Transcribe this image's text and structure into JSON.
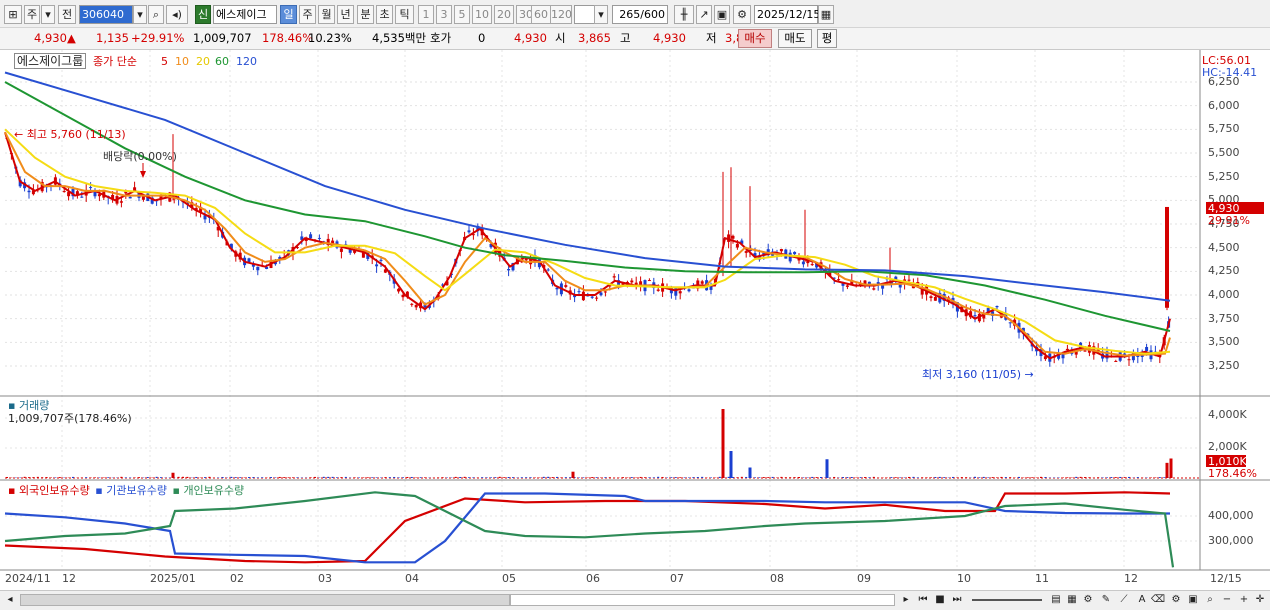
{
  "toolbar": {
    "period_label": "주",
    "prev_label": "전",
    "stock_code": "306040",
    "sin_label": "신",
    "stock_name": "에스제이그",
    "periods": [
      "일",
      "주",
      "월",
      "년",
      "분",
      "초",
      "틱"
    ],
    "intervals": [
      "1",
      "3",
      "5",
      "10",
      "20",
      "30",
      "60",
      "120"
    ],
    "count": "265",
    "count_max": "/600",
    "date": "2025/12/15"
  },
  "quote": {
    "price": "4,930",
    "arrow": "▲",
    "change": "1,135",
    "change_pct": "+29.91%",
    "volume": "1,009,707",
    "vol_ratio": "178.46%",
    "turnover": "10.23%",
    "amount": "4,535백만",
    "hoga_label": "호가",
    "hoga_value": "0",
    "hoga_price": "4,930",
    "open_label": "시",
    "open": "3,865",
    "high_label": "고",
    "high": "4,930",
    "low_label": "저",
    "low": "3,840",
    "buy_label": "매수",
    "sell_label": "매도",
    "eval_label": "평"
  },
  "price_panel": {
    "title": "에스제이그룹",
    "ma_title": "종가 단순",
    "ma_periods": [
      "5",
      "10",
      "20",
      "60",
      "120"
    ],
    "lc": "LC:56.01",
    "hc": "HC:-14.41",
    "last_price": "4,930",
    "last_pct": "29.91%",
    "high_marker": "최고 5,760 (11/13)",
    "low_marker": "최저 3,160 (11/05)",
    "dividend_marker": "배당락(0.00%)",
    "y_ticks": [
      "6,250",
      "6,000",
      "5,750",
      "5,500",
      "5,250",
      "5,000",
      "4,750",
      "4,500",
      "4,250",
      "4,000",
      "3,750",
      "3,500",
      "3,250"
    ]
  },
  "volume_panel": {
    "title": "거래량",
    "value": "1,009,707주(178.46%)",
    "y_ticks": [
      "4,000K",
      "2,000K"
    ],
    "last_value": "1,010K",
    "last_pct": "178.46%"
  },
  "holding_panel": {
    "legend": [
      "외국인보유수량",
      "기관보유수량",
      "개인보유수량"
    ],
    "y_ticks": [
      "400,000",
      "300,000"
    ]
  },
  "x_axis": [
    "2024/11",
    "12",
    "2025/01",
    "02",
    "03",
    "04",
    "05",
    "06",
    "07",
    "08",
    "09",
    "10",
    "11",
    "12",
    "12/15"
  ],
  "colors": {
    "ma5": "#d40000",
    "ma10": "#f08c1a",
    "ma20": "#f5dc14",
    "ma60": "#1e9632",
    "ma120": "#2850d2",
    "foreign": "#d40000",
    "institution": "#2850d2",
    "individual": "#2e8b57"
  },
  "chart_data": {
    "type": "candlestick",
    "title": "에스제이그룹",
    "x_range": [
      "2024/11",
      "2025/12/15"
    ],
    "price_ylim": [
      3160,
      6300
    ],
    "price_series": [
      {
        "name": "종가 단순 5",
        "color": "#d40000",
        "points": [
          [
            0,
            5720
          ],
          [
            15,
            5200
          ],
          [
            30,
            5100
          ],
          [
            50,
            5200
          ],
          [
            70,
            5050
          ],
          [
            90,
            5100
          ],
          [
            110,
            5000
          ],
          [
            130,
            5100
          ],
          [
            150,
            5000
          ],
          [
            170,
            5050
          ],
          [
            190,
            4900
          ],
          [
            210,
            4800
          ],
          [
            225,
            4500
          ],
          [
            240,
            4350
          ],
          [
            260,
            4300
          ],
          [
            280,
            4400
          ],
          [
            300,
            4600
          ],
          [
            320,
            4550
          ],
          [
            340,
            4500
          ],
          [
            360,
            4450
          ],
          [
            380,
            4300
          ],
          [
            400,
            4000
          ],
          [
            420,
            3850
          ],
          [
            430,
            3950
          ],
          [
            445,
            4200
          ],
          [
            460,
            4600
          ],
          [
            475,
            4700
          ],
          [
            490,
            4500
          ],
          [
            505,
            4300
          ],
          [
            520,
            4400
          ],
          [
            535,
            4350
          ],
          [
            550,
            4100
          ],
          [
            570,
            4000
          ],
          [
            590,
            4000
          ],
          [
            610,
            4150
          ],
          [
            630,
            4100
          ],
          [
            650,
            4100
          ],
          [
            670,
            4050
          ],
          [
            690,
            4100
          ],
          [
            710,
            4100
          ],
          [
            720,
            4600
          ],
          [
            735,
            4550
          ],
          [
            750,
            4400
          ],
          [
            770,
            4450
          ],
          [
            790,
            4400
          ],
          [
            810,
            4350
          ],
          [
            830,
            4150
          ],
          [
            850,
            4100
          ],
          [
            870,
            4100
          ],
          [
            890,
            4150
          ],
          [
            910,
            4100
          ],
          [
            930,
            4000
          ],
          [
            950,
            3900
          ],
          [
            970,
            3750
          ],
          [
            990,
            3850
          ],
          [
            1010,
            3700
          ],
          [
            1030,
            3450
          ],
          [
            1045,
            3330
          ],
          [
            1060,
            3400
          ],
          [
            1080,
            3450
          ],
          [
            1100,
            3350
          ],
          [
            1120,
            3350
          ],
          [
            1140,
            3400
          ],
          [
            1155,
            3350
          ],
          [
            1165,
            3750
          ]
        ]
      },
      {
        "name": "종가 단순 10",
        "color": "#f08c1a",
        "points": [
          [
            0,
            5720
          ],
          [
            20,
            5300
          ],
          [
            40,
            5150
          ],
          [
            60,
            5150
          ],
          [
            80,
            5100
          ],
          [
            100,
            5100
          ],
          [
            120,
            5050
          ],
          [
            140,
            5050
          ],
          [
            160,
            5050
          ],
          [
            180,
            5000
          ],
          [
            200,
            4900
          ],
          [
            220,
            4700
          ],
          [
            240,
            4450
          ],
          [
            260,
            4350
          ],
          [
            280,
            4380
          ],
          [
            300,
            4500
          ],
          [
            320,
            4550
          ],
          [
            340,
            4520
          ],
          [
            360,
            4470
          ],
          [
            380,
            4380
          ],
          [
            400,
            4150
          ],
          [
            420,
            3900
          ],
          [
            440,
            4000
          ],
          [
            460,
            4350
          ],
          [
            480,
            4600
          ],
          [
            500,
            4450
          ],
          [
            520,
            4350
          ],
          [
            540,
            4350
          ],
          [
            560,
            4150
          ],
          [
            580,
            4050
          ],
          [
            600,
            4050
          ],
          [
            620,
            4100
          ],
          [
            640,
            4100
          ],
          [
            660,
            4080
          ],
          [
            680,
            4080
          ],
          [
            700,
            4090
          ],
          [
            720,
            4300
          ],
          [
            740,
            4500
          ],
          [
            760,
            4450
          ],
          [
            780,
            4420
          ],
          [
            800,
            4400
          ],
          [
            820,
            4300
          ],
          [
            840,
            4170
          ],
          [
            860,
            4110
          ],
          [
            880,
            4110
          ],
          [
            900,
            4120
          ],
          [
            920,
            4070
          ],
          [
            940,
            3980
          ],
          [
            960,
            3870
          ],
          [
            980,
            3800
          ],
          [
            1000,
            3780
          ],
          [
            1020,
            3600
          ],
          [
            1040,
            3400
          ],
          [
            1060,
            3380
          ],
          [
            1080,
            3430
          ],
          [
            1100,
            3390
          ],
          [
            1120,
            3360
          ],
          [
            1140,
            3370
          ],
          [
            1160,
            3380
          ],
          [
            1165,
            3550
          ]
        ]
      },
      {
        "name": "종가 단순 20",
        "color": "#f5dc14",
        "points": [
          [
            0,
            5750
          ],
          [
            30,
            5450
          ],
          [
            60,
            5250
          ],
          [
            90,
            5150
          ],
          [
            120,
            5100
          ],
          [
            150,
            5080
          ],
          [
            180,
            5050
          ],
          [
            210,
            4920
          ],
          [
            240,
            4650
          ],
          [
            270,
            4450
          ],
          [
            300,
            4450
          ],
          [
            330,
            4520
          ],
          [
            360,
            4520
          ],
          [
            390,
            4440
          ],
          [
            420,
            4200
          ],
          [
            440,
            4050
          ],
          [
            460,
            4220
          ],
          [
            490,
            4480
          ],
          [
            520,
            4450
          ],
          [
            550,
            4330
          ],
          [
            580,
            4180
          ],
          [
            610,
            4100
          ],
          [
            640,
            4090
          ],
          [
            670,
            4080
          ],
          [
            700,
            4080
          ],
          [
            720,
            4160
          ],
          [
            750,
            4380
          ],
          [
            780,
            4420
          ],
          [
            810,
            4400
          ],
          [
            840,
            4320
          ],
          [
            870,
            4200
          ],
          [
            900,
            4140
          ],
          [
            930,
            4080
          ],
          [
            960,
            3960
          ],
          [
            990,
            3850
          ],
          [
            1020,
            3720
          ],
          [
            1050,
            3520
          ],
          [
            1080,
            3450
          ],
          [
            1110,
            3410
          ],
          [
            1140,
            3380
          ],
          [
            1165,
            3400
          ]
        ]
      },
      {
        "name": "종가 단순 60",
        "color": "#1e9632",
        "points": [
          [
            0,
            6250
          ],
          [
            60,
            5900
          ],
          [
            120,
            5550
          ],
          [
            180,
            5250
          ],
          [
            240,
            5000
          ],
          [
            300,
            4850
          ],
          [
            360,
            4780
          ],
          [
            420,
            4620
          ],
          [
            460,
            4500
          ],
          [
            500,
            4420
          ],
          [
            560,
            4360
          ],
          [
            620,
            4290
          ],
          [
            680,
            4250
          ],
          [
            740,
            4240
          ],
          [
            800,
            4240
          ],
          [
            860,
            4250
          ],
          [
            920,
            4210
          ],
          [
            980,
            4100
          ],
          [
            1040,
            3950
          ],
          [
            1100,
            3780
          ],
          [
            1165,
            3620
          ]
        ]
      },
      {
        "name": "종가 단순 120",
        "color": "#2850d2",
        "points": [
          [
            0,
            6350
          ],
          [
            80,
            6100
          ],
          [
            160,
            5850
          ],
          [
            240,
            5500
          ],
          [
            320,
            5150
          ],
          [
            400,
            4900
          ],
          [
            480,
            4700
          ],
          [
            560,
            4530
          ],
          [
            640,
            4390
          ],
          [
            720,
            4300
          ],
          [
            800,
            4270
          ],
          [
            880,
            4260
          ],
          [
            960,
            4200
          ],
          [
            1040,
            4100
          ],
          [
            1100,
            4030
          ],
          [
            1165,
            3940
          ]
        ]
      }
    ],
    "holding_series": [
      {
        "name": "외국인보유수량",
        "color": "#d40000",
        "points": [
          [
            0,
            282
          ],
          [
            80,
            268
          ],
          [
            160,
            238
          ],
          [
            240,
            220
          ],
          [
            300,
            215
          ],
          [
            360,
            220
          ],
          [
            375,
            280
          ],
          [
            400,
            380
          ],
          [
            460,
            470
          ],
          [
            520,
            455
          ],
          [
            600,
            460
          ],
          [
            680,
            460
          ],
          [
            760,
            448
          ],
          [
            820,
            430
          ],
          [
            880,
            445
          ],
          [
            940,
            420
          ],
          [
            990,
            420
          ],
          [
            1000,
            490
          ],
          [
            1060,
            490
          ],
          [
            1120,
            495
          ],
          [
            1165,
            490
          ]
        ]
      },
      {
        "name": "기관보유수량",
        "color": "#2850d2",
        "points": [
          [
            0,
            410
          ],
          [
            60,
            395
          ],
          [
            120,
            370
          ],
          [
            165,
            340
          ],
          [
            170,
            250
          ],
          [
            230,
            245
          ],
          [
            300,
            240
          ],
          [
            360,
            215
          ],
          [
            410,
            215
          ],
          [
            440,
            300
          ],
          [
            480,
            490
          ],
          [
            540,
            490
          ],
          [
            620,
            480
          ],
          [
            640,
            460
          ],
          [
            760,
            460
          ],
          [
            820,
            455
          ],
          [
            960,
            455
          ],
          [
            1000,
            420
          ],
          [
            1060,
            412
          ],
          [
            1120,
            410
          ],
          [
            1165,
            410
          ]
        ]
      },
      {
        "name": "개인보유수량",
        "color": "#2e8b57",
        "points": [
          [
            0,
            300
          ],
          [
            60,
            320
          ],
          [
            120,
            330
          ],
          [
            165,
            360
          ],
          [
            170,
            420
          ],
          [
            230,
            430
          ],
          [
            300,
            460
          ],
          [
            370,
            495
          ],
          [
            410,
            480
          ],
          [
            440,
            420
          ],
          [
            480,
            340
          ],
          [
            520,
            320
          ],
          [
            580,
            315
          ],
          [
            640,
            330
          ],
          [
            700,
            340
          ],
          [
            760,
            360
          ],
          [
            800,
            370
          ],
          [
            880,
            380
          ],
          [
            960,
            400
          ],
          [
            1000,
            440
          ],
          [
            1060,
            450
          ],
          [
            1120,
            425
          ],
          [
            1160,
            410
          ],
          [
            1168,
            195
          ]
        ]
      }
    ]
  }
}
